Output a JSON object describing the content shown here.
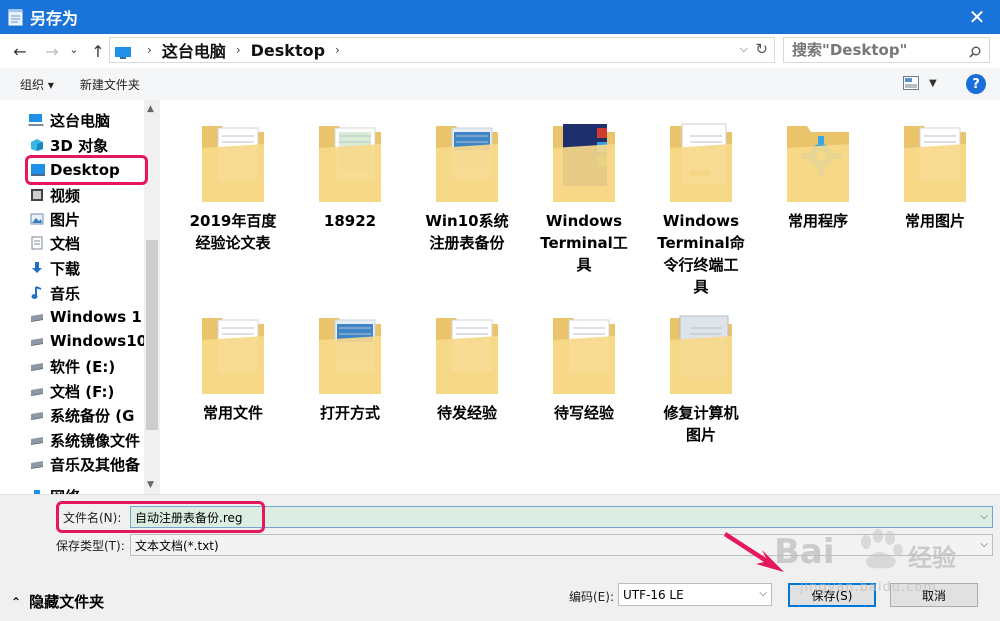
{
  "window": {
    "title": "另存为",
    "close_glyph": "✕"
  },
  "nav": {
    "back": "←",
    "forward": "→",
    "recent": "⌄",
    "up": "↑",
    "breadcrumb": [
      "这台电脑",
      "Desktop"
    ],
    "search_placeholder": "搜索\"Desktop\""
  },
  "toolbar": {
    "organize": "组织 ▾",
    "new_folder": "新建文件夹",
    "help": "?"
  },
  "sidebar": {
    "items": [
      {
        "label": "这台电脑",
        "icon": "computer-icon"
      },
      {
        "label": "3D 对象",
        "icon": "cube-icon"
      },
      {
        "label": "Desktop",
        "icon": "desktop-icon"
      },
      {
        "label": "视频",
        "icon": "video-icon"
      },
      {
        "label": "图片",
        "icon": "picture-icon"
      },
      {
        "label": "文档",
        "icon": "document-icon"
      },
      {
        "label": "下载",
        "icon": "download-icon"
      },
      {
        "label": "音乐",
        "icon": "music-icon"
      },
      {
        "label": "Windows 1",
        "icon": "drive-icon"
      },
      {
        "label": "Windows10",
        "icon": "drive-icon"
      },
      {
        "label": "软件 (E:)",
        "icon": "drive-icon"
      },
      {
        "label": "文档 (F:)",
        "icon": "drive-icon"
      },
      {
        "label": "系统备份 (G",
        "icon": "drive-icon"
      },
      {
        "label": "系统镜像文件",
        "icon": "drive-icon"
      },
      {
        "label": "音乐及其他备",
        "icon": "drive-icon"
      },
      {
        "label": "网络",
        "icon": "network-icon"
      }
    ]
  },
  "files": [
    {
      "label": "2019年百度经验论文表",
      "lines": [
        "2019年百度",
        "经验论文表"
      ]
    },
    {
      "label": "18922",
      "lines": [
        "18922"
      ]
    },
    {
      "label": "Win10系统注册表备份",
      "lines": [
        "Win10系统",
        "注册表备份"
      ]
    },
    {
      "label": "Windows Terminal工具",
      "lines": [
        "Windows",
        "Terminal工",
        "具"
      ]
    },
    {
      "label": "Windows Terminal命令行终端工具",
      "lines": [
        "Windows",
        "Terminal命",
        "令行终端工",
        "具"
      ]
    },
    {
      "label": "常用程序",
      "lines": [
        "常用程序"
      ]
    },
    {
      "label": "常用图片",
      "lines": [
        "常用图片"
      ]
    },
    {
      "label": "常用文件",
      "lines": [
        "常用文件"
      ]
    },
    {
      "label": "打开方式",
      "lines": [
        "打开方式"
      ]
    },
    {
      "label": "待发经验",
      "lines": [
        "待发经验"
      ]
    },
    {
      "label": "待写经验",
      "lines": [
        "待写经验"
      ]
    },
    {
      "label": "修复计算机图片",
      "lines": [
        "修复计算机",
        "图片"
      ]
    }
  ],
  "save": {
    "filename_label": "文件名(N):",
    "filename_value": "自动注册表备份.reg",
    "type_label": "保存类型(T):",
    "type_value": "文本文档(*.txt)",
    "hide_folders": "隐藏文件夹",
    "encoding_label": "编码(E):",
    "encoding_value": "UTF-16 LE",
    "save_button": "保存(S)",
    "cancel_button": "取消"
  },
  "watermark": {
    "brand": "Bai",
    "brand2": "经验",
    "url": "jingyan.baidu.com"
  },
  "colors": {
    "titlebar": "#1a73d9",
    "annotation": "#e5175e",
    "folder": "#f7d98a"
  }
}
